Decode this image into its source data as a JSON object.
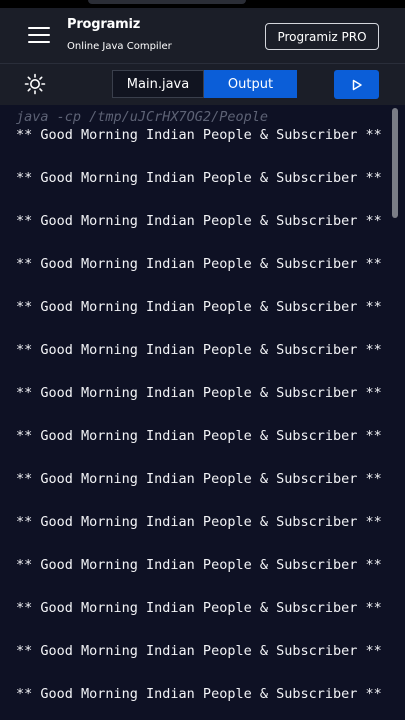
{
  "header": {
    "logo_text": "Programiz",
    "subtitle": "Online Java Compiler",
    "pro_button_label": "Programiz PRO"
  },
  "toolbar": {
    "tabs": [
      {
        "label": "Main.java",
        "active": false
      },
      {
        "label": "Output",
        "active": true
      }
    ],
    "icons": {
      "theme": "sun-icon",
      "run": "play-icon",
      "menu": "hamburger-icon"
    }
  },
  "console": {
    "command": "java -cp /tmp/uJCrHX7OG2/People",
    "lines": [
      "** Good Morning Indian People & Subscriber **",
      "** Good Morning Indian People & Subscriber **",
      "** Good Morning Indian People & Subscriber **",
      "** Good Morning Indian People & Subscriber **",
      "** Good Morning Indian People & Subscriber **",
      "** Good Morning Indian People & Subscriber **",
      "** Good Morning Indian People & Subscriber **",
      "** Good Morning Indian People & Subscriber **",
      "** Good Morning Indian People & Subscriber **",
      "** Good Morning Indian People & Subscriber **",
      "** Good Morning Indian People & Subscriber **",
      "** Good Morning Indian People & Subscriber **",
      "** Good Morning Indian People & Subscriber **",
      "** Good Morning Indian People & Subscriber **"
    ]
  },
  "colors": {
    "header_bg": "#1b1e28",
    "console_bg": "#0e1124",
    "accent": "#0b5ed8",
    "command_text": "#5d6275"
  }
}
